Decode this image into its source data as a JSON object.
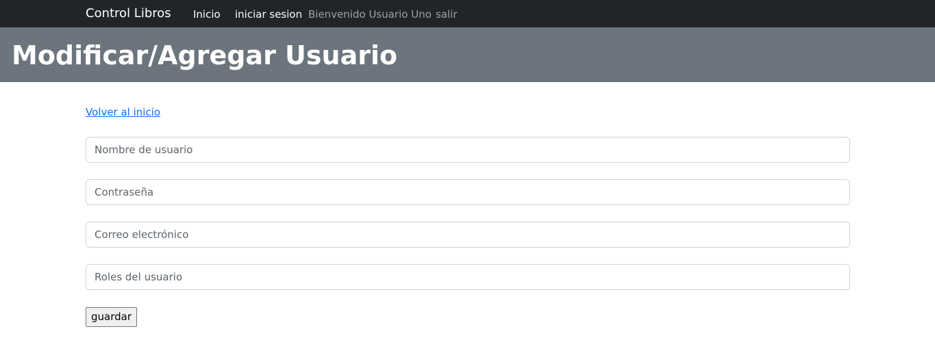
{
  "navbar": {
    "brand": "Control Libros",
    "links": {
      "inicio": "Inicio",
      "login": "iniciar sesion",
      "welcome": "Bienvenido Usuario Uno",
      "logout": "salir"
    }
  },
  "header": {
    "title": "Modificar/Agregar Usuario"
  },
  "main": {
    "back_link": "Volver al inicio",
    "form": {
      "username": {
        "placeholder": "Nombre de usuario",
        "value": ""
      },
      "password": {
        "placeholder": "Contraseña",
        "value": ""
      },
      "email": {
        "placeholder": "Correo electrónico",
        "value": ""
      },
      "roles": {
        "placeholder": "Roles del usuario",
        "value": ""
      },
      "submit_label": "guardar"
    }
  },
  "colors": {
    "navbar_bg": "#212529",
    "header_bg": "#6c757d",
    "link": "#0d6efd"
  }
}
